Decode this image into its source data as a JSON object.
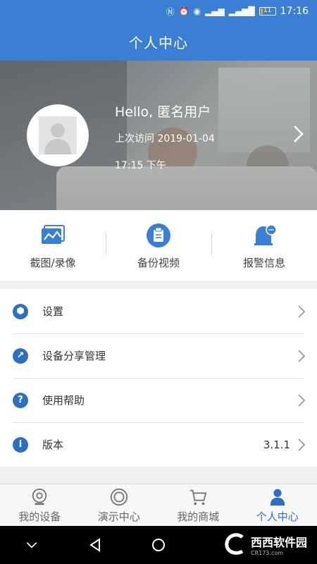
{
  "status_bar": {
    "time": "17:16",
    "battery_label": "11",
    "battery_level": 0.11,
    "icons": [
      "nfc-icon",
      "alarm-icon",
      "eye-icon",
      "signal-2g-icon",
      "signal-4g-icon"
    ]
  },
  "header": {
    "title": "个人中心"
  },
  "profile": {
    "greeting": "Hello, 匿名用户",
    "last_visit": "上次访问 2019-01-04",
    "last_visit_time": "17:15 下午"
  },
  "quick_actions": [
    {
      "label": "截图/录像",
      "icon": "screenshot-icon"
    },
    {
      "label": "备份视频",
      "icon": "backup-video-icon"
    },
    {
      "label": "报警信息",
      "icon": "alarm-bell-icon"
    }
  ],
  "menu": {
    "settings": "设置",
    "share": "设备分享管理",
    "help": "使用帮助",
    "version_label": "版本",
    "version_value": "3.1.1"
  },
  "bottom_nav": [
    {
      "label": "我的设备",
      "icon": "device-icon",
      "active": false
    },
    {
      "label": "演示中心",
      "icon": "demo-icon",
      "active": false
    },
    {
      "label": "我的商城",
      "icon": "cart-icon",
      "active": false
    },
    {
      "label": "个人中心",
      "icon": "person-icon",
      "active": true
    }
  ],
  "watermark": {
    "text": "西西软件园",
    "sub": "CR173.com"
  },
  "colors": {
    "primary": "#3a7fd4",
    "accent": "#2f6fc2"
  }
}
